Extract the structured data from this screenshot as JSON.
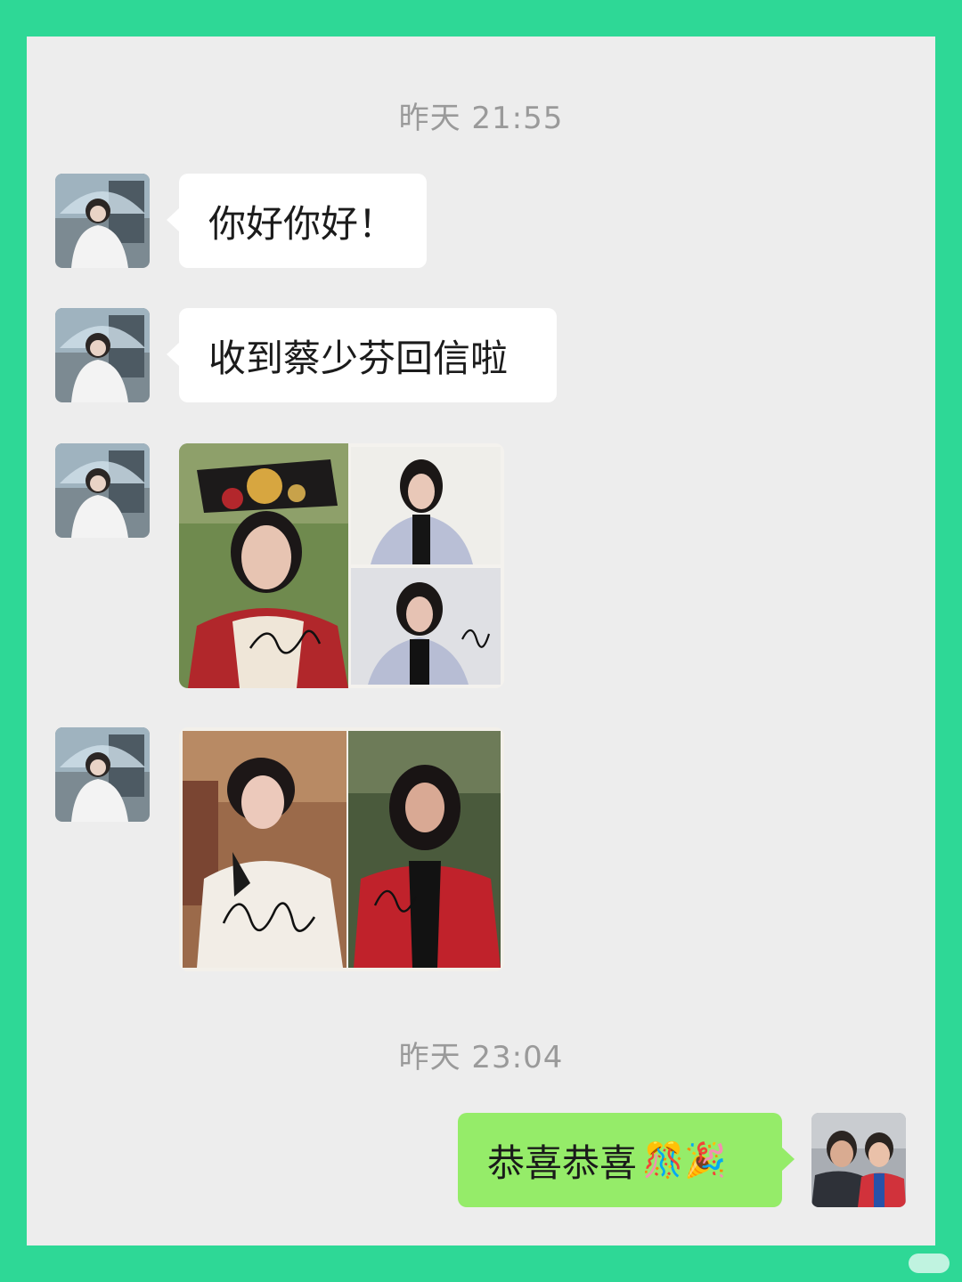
{
  "chat": {
    "timestamp_1": "昨天 21:55",
    "timestamp_2": "昨天 23:04",
    "messages": [
      {
        "sender": "other",
        "type": "text",
        "text": "你好你好！"
      },
      {
        "sender": "other",
        "type": "text",
        "text": "收到蔡少芬回信啦"
      },
      {
        "sender": "other",
        "type": "image",
        "image_semantic": "autographed-photos-qing-costume-and-modern"
      },
      {
        "sender": "other",
        "type": "image",
        "image_semantic": "autographed-photos-period-costume-and-red-jacket"
      },
      {
        "sender": "self",
        "type": "text",
        "text": "恭喜恭喜",
        "emojis": "🎊🎉"
      }
    ]
  },
  "colors": {
    "frame": "#2ed896",
    "chat_bg": "#ededed",
    "incoming_bubble": "#ffffff",
    "outgoing_bubble": "#95ec69",
    "timestamp_text": "#9a9a9a"
  }
}
